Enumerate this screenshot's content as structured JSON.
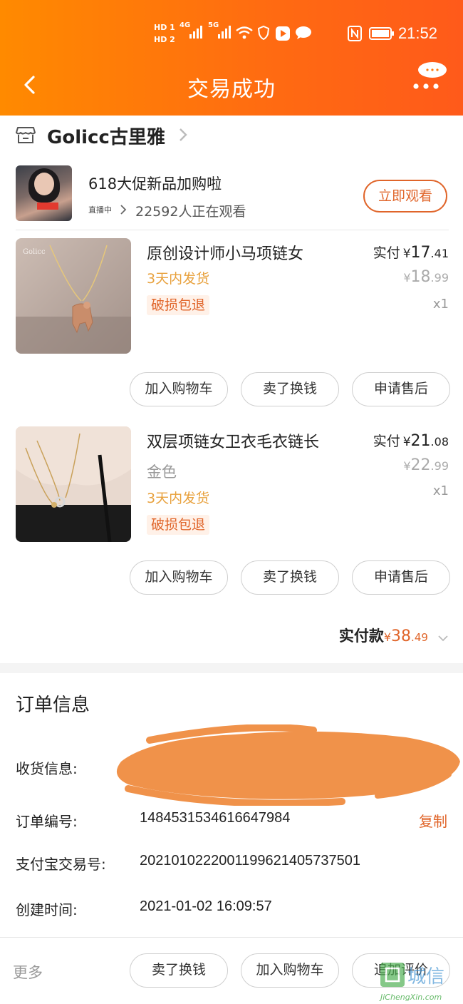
{
  "status_bar": {
    "hd1": "HD 1",
    "hd2": "HD 2",
    "net1": "4G",
    "net2": "5G",
    "time": "21:52"
  },
  "header": {
    "title": "交易成功"
  },
  "shop": {
    "name": "Golicc古里雅"
  },
  "live": {
    "headline": "618大促新品加购啦",
    "flag": "直播中",
    "viewers": "22592人正在观看",
    "button": "立即观看"
  },
  "items": [
    {
      "title": "原创设计师小马项链女",
      "sku": "",
      "shipping": "3天内发货",
      "tag": "破损包退",
      "paid_label": "实付",
      "paid_int": "17",
      "paid_dec": ".41",
      "orig_int": "18",
      "orig_dec": ".99",
      "qty": "x1",
      "buttons": [
        "加入购物车",
        "卖了换钱",
        "申请售后"
      ]
    },
    {
      "title": "双层项链女卫衣毛衣链长",
      "sku": "金色",
      "shipping": "3天内发货",
      "tag": "破损包退",
      "paid_label": "实付",
      "paid_int": "21",
      "paid_dec": ".08",
      "orig_int": "22",
      "orig_dec": ".99",
      "qty": "x1",
      "buttons": [
        "加入购物车",
        "卖了换钱",
        "申请售后"
      ]
    }
  ],
  "currency": "¥",
  "total": {
    "label": "实付款",
    "int": "38",
    "dec": ".49"
  },
  "order_info": {
    "title": "订单信息",
    "receiver_label": "收货信息:",
    "order_no_label": "订单编号:",
    "order_no": "1484531534616647984",
    "copy": "复制",
    "alipay_label": "支付宝交易号:",
    "alipay_no": "2021010222001199621405737501",
    "created_label": "创建时间:",
    "created": "2021-01-02 16:09:57"
  },
  "bottom_bar": {
    "more": "更多",
    "buttons": [
      "卖了换钱",
      "加入购物车",
      "追加评价"
    ]
  },
  "watermark": {
    "text": "JiChengXin.com",
    "cn": "城信"
  },
  "colors": {
    "header": "#ff7a0c",
    "accent": "#e0652a",
    "shipping": "#e8a13d",
    "redaction": "#f0924a"
  }
}
